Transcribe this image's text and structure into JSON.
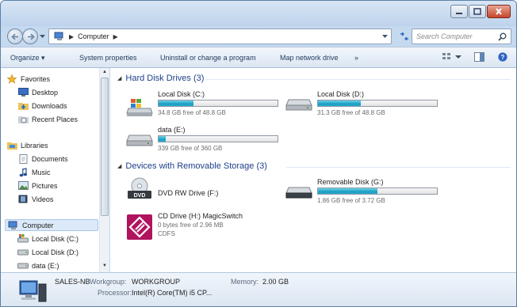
{
  "address": {
    "crumbs": [
      "Computer"
    ],
    "search_placeholder": "Search Computer"
  },
  "toolbar": {
    "organize": "Organize ▾",
    "system_properties": "System properties",
    "uninstall": "Uninstall or change a program",
    "map_drive": "Map network drive",
    "more": "»"
  },
  "nav": {
    "favorites": "Favorites",
    "desktop": "Desktop",
    "downloads": "Downloads",
    "recent": "Recent Places",
    "libraries": "Libraries",
    "documents": "Documents",
    "music": "Music",
    "pictures": "Pictures",
    "videos": "Videos",
    "computer": "Computer",
    "local_c": "Local Disk (C:)",
    "local_d": "Local Disk (D:)",
    "data_e": "data (E:)"
  },
  "groups": {
    "hdd": "Hard Disk Drives (3)",
    "removable": "Devices with Removable Storage (3)"
  },
  "drives": {
    "c": {
      "name": "Local Disk (C:)",
      "free": "34.8 GB free of 48.8 GB",
      "used_fraction": 0.29
    },
    "d": {
      "name": "Local Disk (D:)",
      "free": "31.3 GB free of 48.8 GB",
      "used_fraction": 0.36
    },
    "e": {
      "name": "data (E:)",
      "free": "339 GB free of 360 GB",
      "used_fraction": 0.06
    },
    "f": {
      "name": "DVD RW Drive (F:)"
    },
    "g": {
      "name": "Removable Disk (G:)",
      "free": "1.86 GB free of 3.72 GB",
      "used_fraction": 0.5
    },
    "h": {
      "name": "CD Drive (H:) MagicSwitch",
      "free": "0 bytes free of 2.96 MB",
      "fs": "CDFS"
    }
  },
  "details": {
    "computer_name": "SALES-NB",
    "workgroup_label": "Workgroup:",
    "workgroup_value": "WORKGROUP",
    "memory_label": "Memory:",
    "memory_value": "2.00 GB",
    "processor_label": "Processor:",
    "processor_value": "Intel(R) Core(TM) i5 CP..."
  },
  "colors": {
    "accent": "#1e3f8a",
    "bar_fill": "#1b9ec4",
    "window_frame": "#c5d9ef"
  }
}
